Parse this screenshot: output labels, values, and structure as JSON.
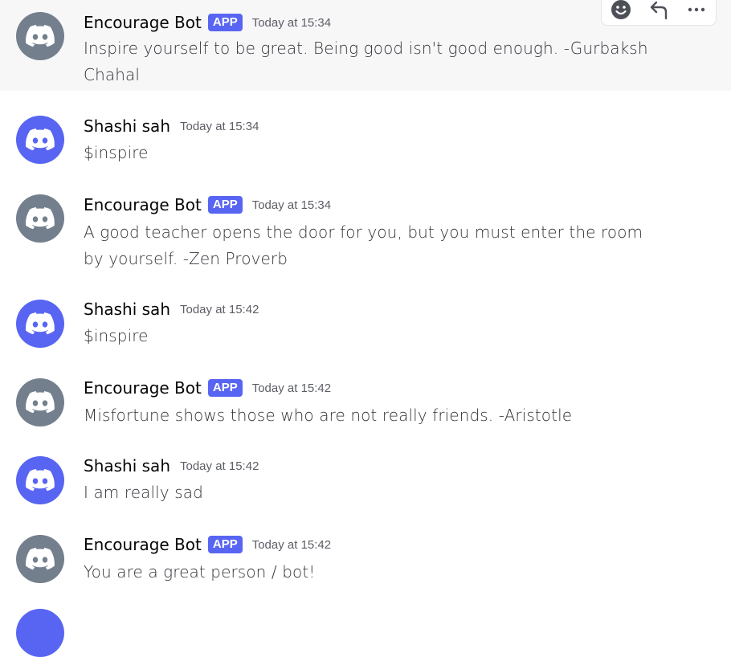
{
  "toolbar": {
    "reaction_icon": "emoji-smile-icon",
    "reply_icon": "reply-arrow-icon",
    "more_icon": "more-dots-icon"
  },
  "messages": [
    {
      "author": "Encourage Bot",
      "badge": "APP",
      "timestamp": "Today at 15:34",
      "text": "Inspire yourself to be great. Being good isn't good enough. -Gurbaksh Chahal"
    },
    {
      "author": "Shashi sah",
      "timestamp": "Today at 15:34",
      "text": "$inspire"
    },
    {
      "author": "Encourage Bot",
      "badge": "APP",
      "timestamp": "Today at 15:34",
      "text": "A good teacher opens the door for you, but you must enter the room by yourself. -Zen Proverb"
    },
    {
      "author": "Shashi sah",
      "timestamp": "Today at 15:42",
      "text": "$inspire"
    },
    {
      "author": "Encourage Bot",
      "badge": "APP",
      "timestamp": "Today at 15:42",
      "text": "Misfortune shows those who are not really friends. -Aristotle"
    },
    {
      "author": "Shashi sah",
      "timestamp": "Today at 15:42",
      "text": "I am really sad"
    },
    {
      "author": "Encourage Bot",
      "badge": "APP",
      "timestamp": "Today at 15:42",
      "text": "You are a great person / bot!"
    }
  ],
  "colors": {
    "bot_avatar": "#747f8d",
    "user_avatar": "#5865f2",
    "badge": "#5865f2"
  }
}
